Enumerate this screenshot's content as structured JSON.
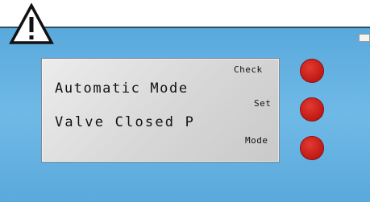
{
  "display": {
    "line1": "Automatic Mode",
    "line2": "Valve Closed P"
  },
  "buttons": {
    "check_label": "Check",
    "set_label": "Set",
    "mode_label": "Mode",
    "color": "#c61d18"
  },
  "icons": {
    "warning": "warning-triangle-icon"
  },
  "colors": {
    "panel": "#6fb9e6",
    "lcd": "#d7d7d7",
    "button": "#c61d18"
  }
}
